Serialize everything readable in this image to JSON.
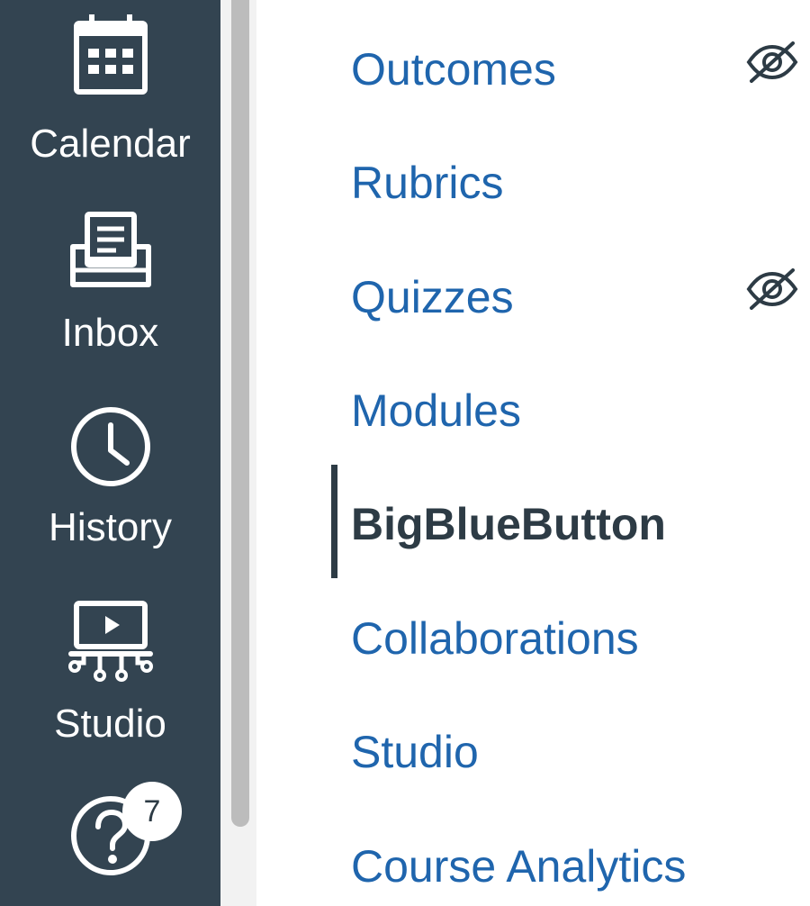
{
  "global_nav": {
    "items": [
      {
        "label": "Calendar",
        "icon": "calendar-icon"
      },
      {
        "label": "Inbox",
        "icon": "inbox-icon"
      },
      {
        "label": "History",
        "icon": "clock-icon"
      },
      {
        "label": "Studio",
        "icon": "studio-icon"
      },
      {
        "label": "",
        "icon": "help-icon",
        "badge": "7"
      }
    ],
    "colors": {
      "background": "#334451",
      "text": "#ffffff"
    }
  },
  "course_nav": {
    "items": [
      {
        "label": "Outcomes",
        "hidden_from_students": true
      },
      {
        "label": "Rubrics",
        "hidden_from_students": false
      },
      {
        "label": "Quizzes",
        "hidden_from_students": true
      },
      {
        "label": "Modules",
        "hidden_from_students": false
      },
      {
        "label": "BigBlueButton",
        "active": true
      },
      {
        "label": "Collaborations",
        "hidden_from_students": false
      },
      {
        "label": "Studio",
        "hidden_from_students": false
      },
      {
        "label": "Course Analytics",
        "hidden_from_students": false
      }
    ],
    "hidden_icon": "eye-slash-icon",
    "colors": {
      "link": "#1f65ad",
      "active": "#2d3b45"
    }
  }
}
